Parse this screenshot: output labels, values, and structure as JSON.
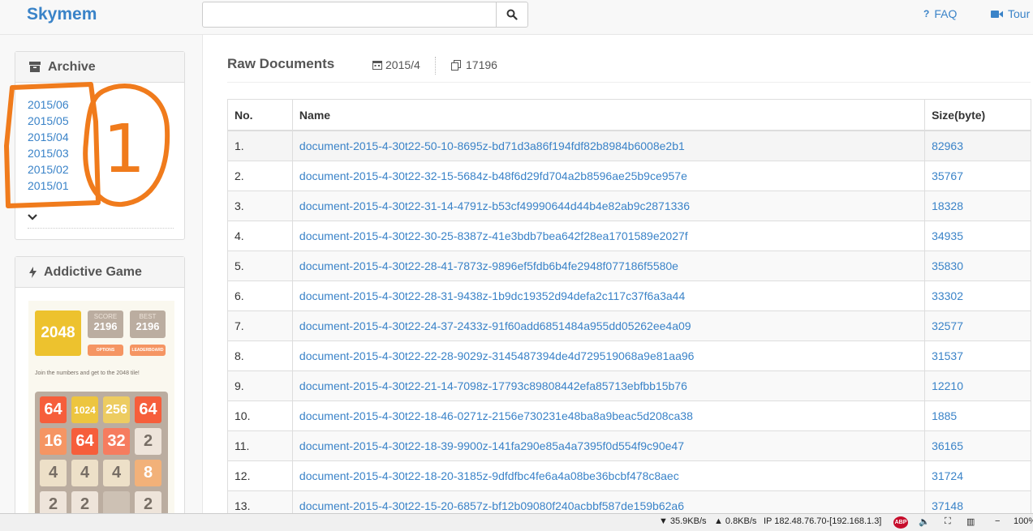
{
  "header": {
    "brand": "Skymem",
    "search": {
      "value": "",
      "placeholder": ""
    },
    "search_icon": "search-icon",
    "nav": [
      {
        "label": "FAQ",
        "icon": "question-icon"
      },
      {
        "label": "Tour",
        "icon": "video-camera-icon"
      }
    ]
  },
  "sidebar": {
    "archive": {
      "title": "Archive",
      "icon": "archive-box-icon",
      "items": [
        "2015/06",
        "2015/05",
        "2015/04",
        "2015/03",
        "2015/02",
        "2015/01"
      ],
      "more_icon": "chevron-down-icon",
      "annotation_mark": "1"
    },
    "game": {
      "title": "Addictive Game",
      "icon": "bolt-icon",
      "logo": "2048",
      "score_label": "SCORE",
      "score": "2196",
      "best_label": "BEST",
      "best": "2196",
      "options_label": "OPTIONS",
      "leaderboard_label": "LEADERBOARD",
      "tagline": "Join the numbers and get to the 2048 tile!",
      "tiles": [
        [
          "64",
          "1024",
          "256",
          "64"
        ],
        [
          "16",
          "64",
          "32",
          "2"
        ],
        [
          "4",
          "4",
          "4",
          "8"
        ],
        [
          "2",
          "2",
          "",
          "2"
        ]
      ]
    }
  },
  "main": {
    "title": "Raw Documents",
    "date": "2015/4",
    "date_icon": "calendar-icon",
    "count": "17196",
    "count_icon": "copy-icon",
    "columns": [
      "No.",
      "Name",
      "Size(byte)"
    ],
    "rows": [
      {
        "no": "1.",
        "name": "document-2015-4-30t22-50-10-8695z-bd71d3a86f194fdf82b8984b6008e2b1",
        "size": "82963"
      },
      {
        "no": "2.",
        "name": "document-2015-4-30t22-32-15-5684z-b48f6d29fd704a2b8596ae25b9ce957e",
        "size": "35767"
      },
      {
        "no": "3.",
        "name": "document-2015-4-30t22-31-14-4791z-b53cf49990644d44b4e82ab9c2871336",
        "size": "18328"
      },
      {
        "no": "4.",
        "name": "document-2015-4-30t22-30-25-8387z-41e3bdb7bea642f28ea1701589e2027f",
        "size": "34935"
      },
      {
        "no": "5.",
        "name": "document-2015-4-30t22-28-41-7873z-9896ef5fdb6b4fe2948f077186f5580e",
        "size": "35830"
      },
      {
        "no": "6.",
        "name": "document-2015-4-30t22-28-31-9438z-1b9dc19352d94defa2c117c37f6a3a44",
        "size": "33302"
      },
      {
        "no": "7.",
        "name": "document-2015-4-30t22-24-37-2433z-91f60add6851484a955dd05262ee4a09",
        "size": "32577"
      },
      {
        "no": "8.",
        "name": "document-2015-4-30t22-22-28-9029z-3145487394de4d729519068a9e81aa96",
        "size": "31537"
      },
      {
        "no": "9.",
        "name": "document-2015-4-30t22-21-14-7098z-17793c89808442efa85713ebfbb15b76",
        "size": "12210"
      },
      {
        "no": "10.",
        "name": "document-2015-4-30t22-18-46-0271z-2156e730231e48ba8a9beac5d208ca38",
        "size": "1885"
      },
      {
        "no": "11.",
        "name": "document-2015-4-30t22-18-39-9900z-141fa290e85a4a7395f0d554f9c90e47",
        "size": "36165"
      },
      {
        "no": "12.",
        "name": "document-2015-4-30t22-18-20-3185z-9dfdfbc4fe6a4a08be36bcbf478c8aec",
        "size": "31724"
      },
      {
        "no": "13.",
        "name": "document-2015-4-30t22-15-20-6857z-bf12b09080f240acbbf587de159b62a6",
        "size": "37148"
      }
    ]
  },
  "statusbar": {
    "download": "35.9KB/s",
    "upload": "0.8KB/s",
    "ip": "IP 182.48.76.70-[192.168.1.3]",
    "abp": "ABP",
    "zoom": "100%"
  },
  "colors": {
    "link": "#3a83c8",
    "annotation": "#f07b1c",
    "tile_2048_logo": "#edc22e",
    "abp_badge": "#c70d2c"
  }
}
